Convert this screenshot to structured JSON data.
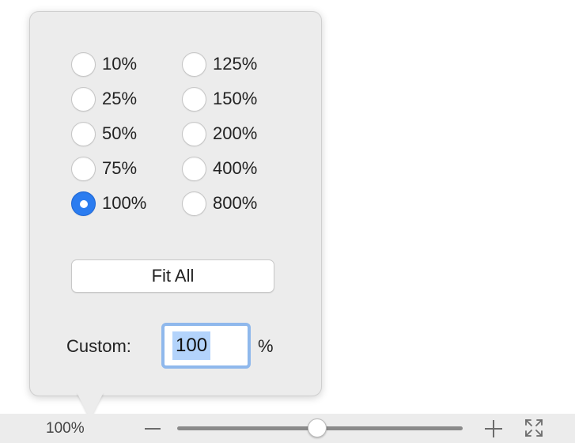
{
  "zoom_popover": {
    "options_left": [
      {
        "label": "10%",
        "selected": false
      },
      {
        "label": "25%",
        "selected": false
      },
      {
        "label": "50%",
        "selected": false
      },
      {
        "label": "75%",
        "selected": false
      },
      {
        "label": "100%",
        "selected": true
      }
    ],
    "options_right": [
      {
        "label": "125%",
        "selected": false
      },
      {
        "label": "150%",
        "selected": false
      },
      {
        "label": "200%",
        "selected": false
      },
      {
        "label": "400%",
        "selected": false
      },
      {
        "label": "800%",
        "selected": false
      }
    ],
    "fit_all_label": "Fit All",
    "custom_label": "Custom:",
    "custom_value": "100",
    "custom_unit": "%"
  },
  "zoom_bar": {
    "zoom_value": "100%",
    "slider_level_percent": 46,
    "icons": {
      "zoom_out": "minus-icon",
      "zoom_in": "plus-icon",
      "fullscreen": "fullscreen-icon"
    }
  },
  "colors": {
    "accent": "#2b7cf0",
    "selection_highlight": "#b3d3fb",
    "focus_ring": "#8fb8ec",
    "panel_background": "#ececec"
  }
}
